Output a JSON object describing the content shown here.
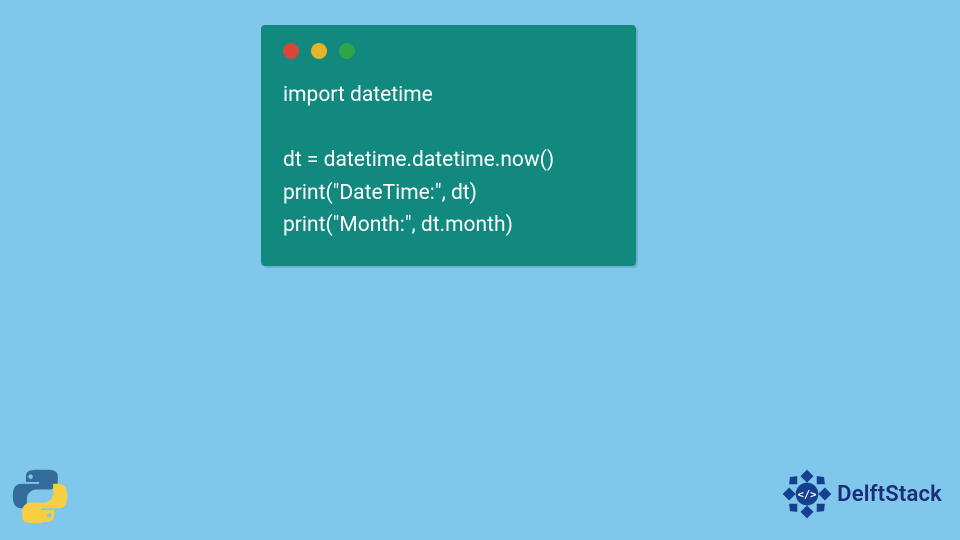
{
  "colors": {
    "bg": "#7fc8eb",
    "window": "#12897f",
    "code_text": "#ffffff",
    "dot_red": "#d6473a",
    "dot_yellow": "#e2b52a",
    "dot_green": "#2fa44b",
    "python_blue": "#336c9b",
    "python_yellow": "#f8cf42",
    "delft_blue": "#163f8f",
    "delft_text_blue": "#1b2c78"
  },
  "code": {
    "lines": [
      "import datetime",
      "",
      "dt = datetime.datetime.now()",
      "print(\"DateTime:\", dt)",
      "print(\"Month:\", dt.month)"
    ]
  },
  "brand": {
    "name": "DelftStack",
    "badge_text": "</>"
  },
  "icons": {
    "python": "python-logo",
    "delft": "delftstack-logo"
  }
}
